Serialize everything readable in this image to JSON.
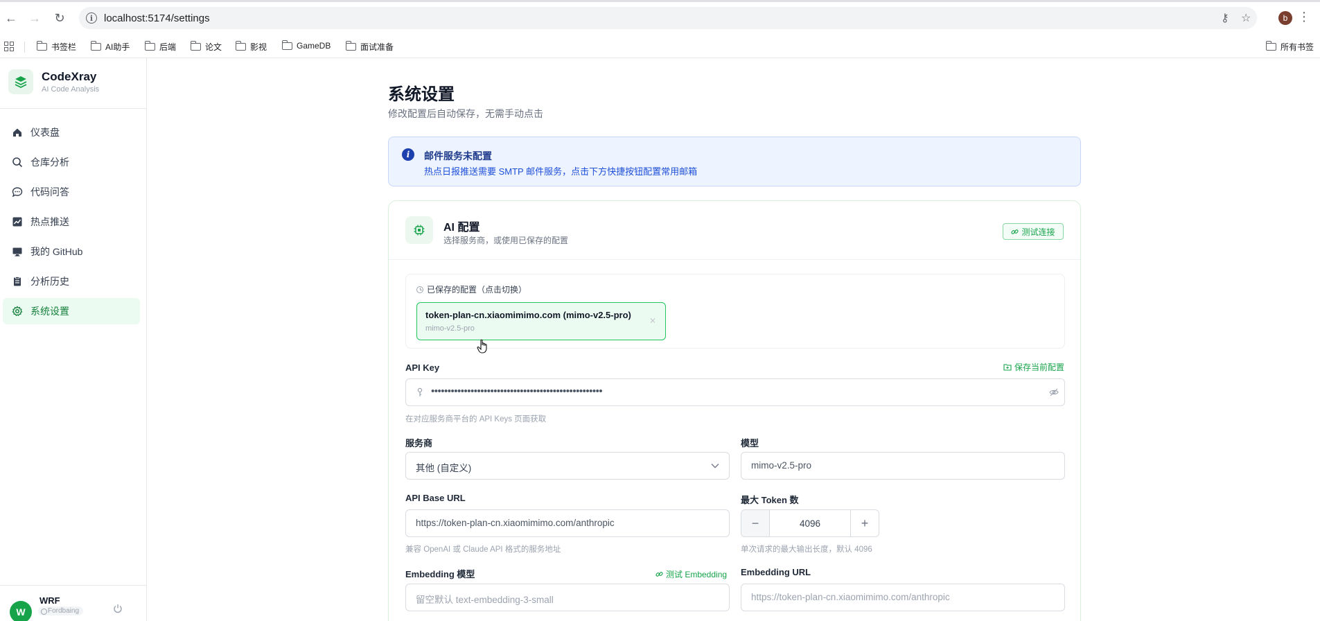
{
  "browser": {
    "url": "localhost:5174/settings",
    "bookmarks": [
      "书签栏",
      "AI助手",
      "后端",
      "论文",
      "影视",
      "GameDB",
      "面试准备"
    ],
    "all_bookmarks": "所有书签",
    "profile_initial": "b"
  },
  "sidebar": {
    "brand_name": "CodeXray",
    "brand_sub": "AI Code Analysis",
    "items": [
      {
        "label": "仪表盘",
        "icon": "home-icon"
      },
      {
        "label": "仓库分析",
        "icon": "search-icon"
      },
      {
        "label": "代码问答",
        "icon": "chat-icon"
      },
      {
        "label": "热点推送",
        "icon": "trend-icon"
      },
      {
        "label": "我的 GitHub",
        "icon": "monitor-icon"
      },
      {
        "label": "分析历史",
        "icon": "clipboard-icon"
      },
      {
        "label": "系统设置",
        "icon": "gear-icon",
        "active": true
      }
    ],
    "user": {
      "initial": "W",
      "name": "WRF",
      "badge": "Fordbaing"
    }
  },
  "page": {
    "title": "系统设置",
    "subtitle": "修改配置后自动保存，无需手动点击"
  },
  "alert": {
    "title": "邮件服务未配置",
    "text": "热点日报推送需要 SMTP 邮件服务，点击下方快捷按钮配置常用邮箱"
  },
  "ai_config": {
    "title": "AI 配置",
    "subtitle": "选择服务商，或使用已保存的配置",
    "test_button": "测试连接",
    "saved_label": "已保存的配置（点击切换）",
    "saved_chip": {
      "title": "token-plan-cn.xiaomimimo.com (mimo-v2.5-pro)",
      "sub": "mimo-v2.5-pro"
    },
    "api_key_label": "API Key",
    "save_current": "保存当前配置",
    "api_key_value": "••••••••••••••••••••••••••••••••••••••••••••••••••••",
    "api_key_hint": "在对应服务商平台的 API Keys 页面获取",
    "provider_label": "服务商",
    "provider_value": "其他 (自定义)",
    "model_label": "模型",
    "model_value": "mimo-v2.5-pro",
    "base_url_label": "API Base URL",
    "base_url_value": "https://token-plan-cn.xiaomimimo.com/anthropic",
    "base_url_hint": "兼容 OpenAI 或 Claude API 格式的服务地址",
    "max_tokens_label": "最大 Token 数",
    "max_tokens_value": "4096",
    "max_tokens_hint": "单次请求的最大输出长度，默认 4096",
    "embedding_label": "Embedding 模型",
    "test_embedding": "测试 Embedding",
    "embedding_placeholder": "留空默认 text-embedding-3-small",
    "embedding_url_label": "Embedding URL",
    "embedding_url_placeholder": "https://token-plan-cn.xiaomimimo.com/anthropic"
  },
  "colors": {
    "accent": "#16a34a",
    "info": "#1e40af"
  }
}
